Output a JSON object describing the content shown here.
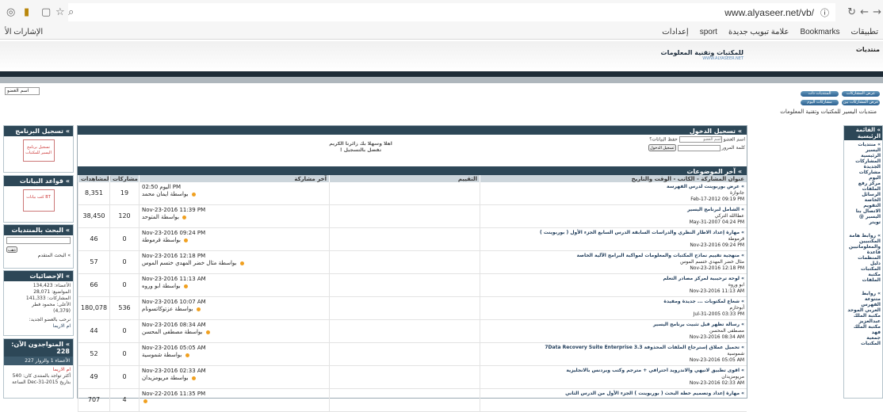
{
  "browser": {
    "url": "www.alyaseer.net/vb/",
    "bookmarks": [
      "تطبيقات",
      "Bookmarks",
      "علامة تبويب جديدة",
      "sport",
      "إعدادات"
    ],
    "bookmarks_left": "الإشارات الأ"
  },
  "site": {
    "name": "منتديات",
    "logo_title": "للمكتبات وتقنية المعلومات",
    "logo_sub": "WWW.ALYASEER.NET",
    "breadcrumb": "منتديات اليسير للمكتبات وتقنية المعلومات",
    "login_field": "اسم العضو",
    "pills": [
      "عرض المشاركات الجديدة",
      "المنتديات ذات المشاركات",
      "عرض المشاركات بين",
      "مشاركات اليوم"
    ]
  },
  "right_nav": {
    "title": "» القائمة الرئيسية",
    "items": [
      "» منتديات اليسير",
      "الرئيسية",
      "المشاركات",
      "الجديدة",
      "مشاركات",
      "اليوم",
      "مركز رفع",
      "الملفات",
      "الرسائل",
      "الخاصة",
      "التقويم",
      "الاتصال بنا",
      "اليسير @",
      "تويتر"
    ],
    "links_title": "» روابط هامة",
    "links": [
      "المكتبيين",
      "والمعلوماتيين",
      "قاعدة",
      "المنظمات",
      "دليل",
      "المكتبات",
      "مكتبة",
      "الملفات"
    ],
    "links2_title": "» روابط متنوعة",
    "links2": [
      "الفهرس",
      "العربي الموحد",
      "مكتبة الملك",
      "عبدالعزيز",
      "مكتبة الملك",
      "فهد",
      "جمعية",
      "المكتبات"
    ]
  },
  "login": {
    "title": "» تسجيل الدخول",
    "username_label": "اسم العضو",
    "password_label": "كلمة المرور",
    "remember": "حفظ البيانات؟",
    "username_placeholder": "اسم العضو",
    "login_button": "تسجيل الدخول",
    "welcome": "اهلا وسهلا بك زائرنا الكريم",
    "register": "تفضل بالتسجيل !"
  },
  "topics": {
    "title": "» آخر الموضوعات",
    "columns": [
      "المشاهدات",
      "مشاركات",
      "آخر مشاركة",
      "التقييم",
      "عنوان المشاركة - الكاتب - الوقت والتاريخ"
    ],
    "rows": [
      {
        "views": "8,351",
        "replies": "19",
        "last_date": "اليوم 02:50 PM",
        "last_by": "بواسطة ايمان محمد",
        "title": "» عرض بوربوينت لدرس الفهرسة",
        "author": "جانوازة",
        "date": "Feb-17-2012 09:19 PM"
      },
      {
        "views": "38,450",
        "replies": "120",
        "last_date": "Nov-23-2016 11:39 PM",
        "last_by": "بواسطة المتوحد",
        "title": "» الشامل لبرنامج اليسير",
        "author": "عطاالله التركي",
        "date": "May-31-2007 04:24 PM"
      },
      {
        "views": "46",
        "replies": "0",
        "last_date": "Nov-23-2016 09:24 PM",
        "last_by": "بواسطة قرموطة",
        "title": "» مهارة إعداد الاطار النظري والدراسات السابقة الدرس السابع الجزء الأول ( بوربوينت )",
        "author": "قرموطة",
        "date": "Nov-23-2016 09:24 PM"
      },
      {
        "views": "57",
        "replies": "0",
        "last_date": "Nov-23-2016 12:18 PM",
        "last_by": "بواسطة مثال خضر المهدي ختسم الموس",
        "title": "» منهجية تقييم نماذج المكتبات والمعلومات لمواكبة البرامج الآلية الخاصة",
        "author": "مثال خضر المهدي ختسم الموس",
        "date": "Nov-23-2016 12:18 PM"
      },
      {
        "views": "66",
        "replies": "0",
        "last_date": "Nov-23-2016 11:13 AM",
        "last_by": "بواسطة ابو وروه",
        "title": "» لوحة ترحيبية لمركز مصادر التعلم",
        "author": "ابو وروه",
        "date": "Nov-23-2016 11:13 AM"
      },
      {
        "views": "180,078",
        "replies": "536",
        "last_date": "Nov-23-2016 10:07 AM",
        "last_by": "بواسطة عزتوكاتسونام",
        "title": "» شعاع لمكتوبات ... جديدة ومفيدة",
        "author": "أبوحازم",
        "date": "Jul-31-2005 03:33 PM"
      },
      {
        "views": "44",
        "replies": "0",
        "last_date": "Nov-23-2016 08:34 AM",
        "last_by": "بواسطة مصطفى المحسن",
        "title": "» رسالة تظهر قبل تثبيت برنامج اليسير",
        "author": "مصطفى المحسن",
        "date": "Nov-23-2016 08:34 AM"
      },
      {
        "views": "52",
        "replies": "0",
        "last_date": "Nov-23-2016 05:05 AM",
        "last_by": "بواسطة شموسية",
        "title": "» تحميل عملاق إسترجاع الملفات المحذوفة 7Data Recovery Suite Enterprise 3.3",
        "author": "شموسية",
        "date": "Nov-23-2016 05:05 AM"
      },
      {
        "views": "49",
        "replies": "0",
        "last_date": "Nov-23-2016 02:33 AM",
        "last_by": "بواسطة مريومزيدان",
        "title": "» اقوى تطبيق لانيهي والاندرويد احترافي + مترجم وكتب ويردنس بالانجليزية",
        "author": "مريومزيدان",
        "date": "Nov-23-2016 02:33 AM"
      },
      {
        "views": "707",
        "replies": "4",
        "last_date": "Nov-22-2016 11:35 PM",
        "last_by": "",
        "title": "» مهارة إعداد وتصميم خطة البحث ( بوربوينت ) الجزء الأول من الدرس الثاني",
        "author": "",
        "date": ""
      }
    ]
  },
  "left": {
    "program_title": "» تسجيل البرنامج",
    "program_btn": "تسجيل برنامج اليسير للمكتبات",
    "db_title": "» قواعد البيانات",
    "db_btn": "كتب بيانات BT",
    "search_title": "» البحث بالمنتديات",
    "search_button": "ذهب",
    "advanced_search": "» البحث المتقدم",
    "stats_title": "» الإحصائيات",
    "stats": [
      "الأعضاء: 134,423",
      "المواضيع: 28,071",
      "المشاركات: 141,333",
      "الأعلى: محمود فطر",
      "(4,379)",
      "نرحب بالعضو الجديد:",
      "ام الاريما"
    ],
    "online_title": "» المتواجدون الآن: 228",
    "online_sub": "الأعضاء 1 والزوار 227",
    "online_user": "ام الاريما",
    "online_record": "أكثر تواجد بالمنتدى كان: 540 بتاريخ Dec-31-2015 الساعة"
  }
}
